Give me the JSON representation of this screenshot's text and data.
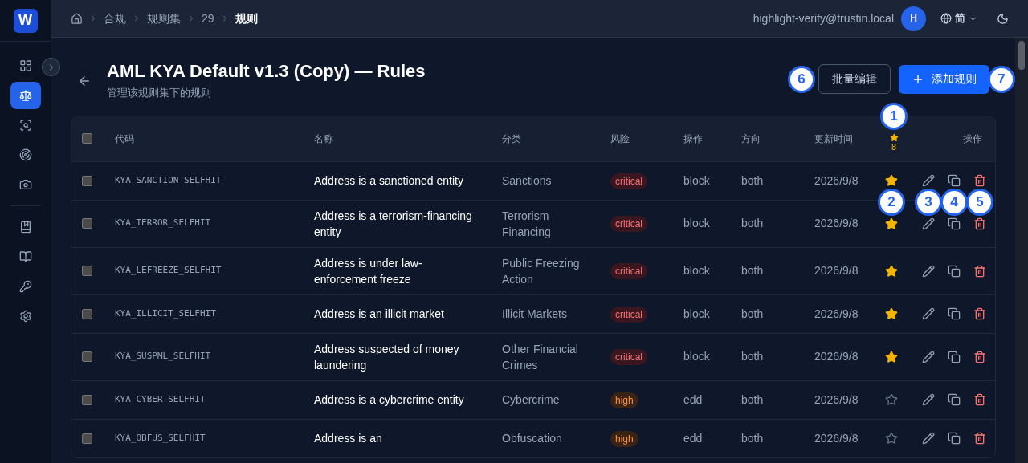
{
  "logo": {
    "letter": "W"
  },
  "sidebar": {
    "groups": [
      {
        "items": [
          {
            "selected": false
          },
          {
            "selected": true
          },
          {
            "selected": false
          },
          {
            "selected": false
          },
          {
            "selected": false
          }
        ]
      },
      {
        "items": [
          {
            "selected": false
          },
          {
            "selected": false
          },
          {
            "selected": false
          },
          {
            "selected": false
          }
        ]
      }
    ]
  },
  "breadcrumbs": [
    {
      "label": "合规",
      "current": false
    },
    {
      "label": "规则集",
      "current": false
    },
    {
      "label": "29",
      "current": false
    },
    {
      "label": "规则",
      "current": true
    }
  ],
  "user": {
    "email": "highlight-verify@trustin.local",
    "avatar": "H"
  },
  "language": "简",
  "page": {
    "title": "AML KYA Default v1.3 (Copy) — Rules",
    "subtitle": "管理该规则集下的规则"
  },
  "buttons": [
    {
      "kind": "secondary",
      "label": "批量编辑"
    },
    {
      "kind": "primary",
      "label": "添加规则"
    }
  ],
  "table": {
    "select_all": {
      "checked": false
    },
    "columns": [
      "代码",
      "名称",
      "分类",
      "风险",
      "操作",
      "方向",
      "更新时间"
    ],
    "star_count": "8",
    "actions_header": "操作",
    "rows": [
      {
        "checked": false,
        "code": "KYA_SANCTION_SELFHIT",
        "name": "Address is a sanctioned entity",
        "category": "Sanctions",
        "risk": "critical",
        "action": "block",
        "direction": "both",
        "updated": "2026/9/8",
        "starred": true
      },
      {
        "checked": false,
        "code": "KYA_TERROR_SELFHIT",
        "name": "Address is a terrorism-financing entity",
        "category": "Terrorism Financing",
        "risk": "critical",
        "action": "block",
        "direction": "both",
        "updated": "2026/9/8",
        "starred": true
      },
      {
        "checked": false,
        "code": "KYA_LEFREEZE_SELFHIT",
        "name": "Address is under law-enforcement freeze",
        "category": "Public Freezing Action",
        "risk": "critical",
        "action": "block",
        "direction": "both",
        "updated": "2026/9/8",
        "starred": true
      },
      {
        "checked": false,
        "code": "KYA_ILLICIT_SELFHIT",
        "name": "Address is an illicit market",
        "category": "Illicit Markets",
        "risk": "critical",
        "action": "block",
        "direction": "both",
        "updated": "2026/9/8",
        "starred": true
      },
      {
        "checked": false,
        "code": "KYA_SUSPML_SELFHIT",
        "name": "Address suspected of money laundering",
        "category": "Other Financial Crimes",
        "risk": "critical",
        "action": "block",
        "direction": "both",
        "updated": "2026/9/8",
        "starred": true
      },
      {
        "checked": false,
        "code": "KYA_CYBER_SELFHIT",
        "name": "Address is a cybercrime entity",
        "category": "Cybercrime",
        "risk": "high",
        "action": "edd",
        "direction": "both",
        "updated": "2026/9/8",
        "starred": false
      },
      {
        "checked": false,
        "code": "KYA_OBFUS_SELFHIT",
        "name": "Address is an",
        "category": "Obfuscation",
        "risk": "high",
        "action": "edd",
        "direction": "both",
        "updated": "2026/9/8",
        "starred": false
      }
    ]
  },
  "annotations": [
    {
      "label": "1"
    },
    {
      "label": "2"
    },
    {
      "label": "3"
    },
    {
      "label": "4"
    },
    {
      "label": "5"
    },
    {
      "label": "6"
    },
    {
      "label": "7"
    }
  ]
}
